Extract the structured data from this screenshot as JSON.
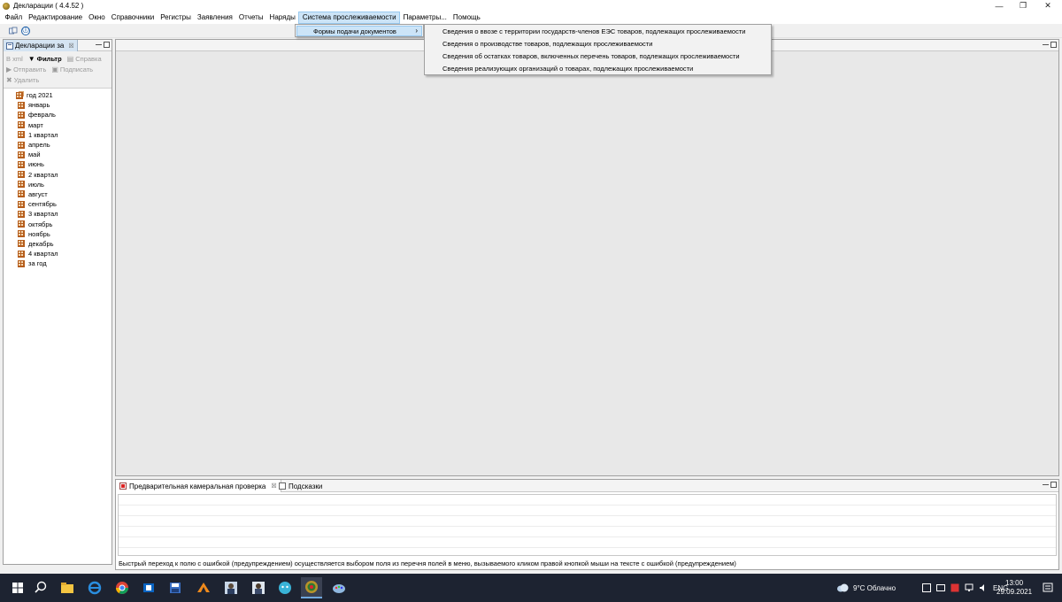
{
  "window": {
    "title": "Декларации ( 4.4.52 )",
    "controls": {
      "minimize": "—",
      "restore": "❐",
      "close": "✕"
    }
  },
  "menubar": {
    "items": [
      {
        "label": "Файл"
      },
      {
        "label": "Редактирование"
      },
      {
        "label": "Окно"
      },
      {
        "label": "Справочники"
      },
      {
        "label": "Регистры"
      },
      {
        "label": "Заявления"
      },
      {
        "label": "Отчеты"
      },
      {
        "label": "Наряды"
      },
      {
        "label": "Система прослеживаемости",
        "active": true
      },
      {
        "label": "Параметры..."
      },
      {
        "label": "Помощь"
      }
    ]
  },
  "toolbar": {
    "info_icon": "ⓘ",
    "sync_icon": "sync-icon"
  },
  "submenu": {
    "label": "Формы подачи документов",
    "arrow": "›",
    "items": [
      {
        "label": "Сведения о ввозе с территории государств-членов ЕЭС товаров, подлежащих прослеживаемости"
      },
      {
        "label": "Сведения о производстве товаров, подлежащих прослеживаемости"
      },
      {
        "label": "Сведения об остатках товаров, включенных перечень товаров, подлежащих прослеживаемости"
      },
      {
        "label": "Сведения реализующих организаций о товарах, подлежащих прослеживаемости"
      }
    ]
  },
  "left_panel": {
    "tab_label": "Декларации за",
    "tab_close": "☒",
    "actions": {
      "xml": "В xml",
      "filter": "Фильтр",
      "help": "Справка",
      "send": "Отправить",
      "sign": "Подписать",
      "delete": "Удалить"
    },
    "tree": {
      "root": "год 2021",
      "items": [
        {
          "label": "январь"
        },
        {
          "label": "февраль"
        },
        {
          "label": "март"
        },
        {
          "label": "1 квартал"
        },
        {
          "label": "апрель"
        },
        {
          "label": "май"
        },
        {
          "label": "июнь"
        },
        {
          "label": "2 квартал"
        },
        {
          "label": "июль"
        },
        {
          "label": "август"
        },
        {
          "label": "сентябрь"
        },
        {
          "label": "3 квартал"
        },
        {
          "label": "октябрь"
        },
        {
          "label": "ноябрь"
        },
        {
          "label": "декабрь"
        },
        {
          "label": "4 квартал"
        },
        {
          "label": "за год"
        }
      ]
    }
  },
  "bottom_panel": {
    "tabs": [
      {
        "label": "Предварительная камеральная проверка",
        "close": "☒"
      },
      {
        "label": "Подсказки"
      }
    ],
    "status": "Быстрый переход к полю с ошибкой (предупреждением) осуществляется выбором поля из перечня полей в меню, вызываемого кликом правой кнопкой мыши на тексте с ошибкой (предупреждением)"
  },
  "taskbar": {
    "weather": "9°C  Облачно",
    "language": "ENG",
    "time": "13:00",
    "date": "29.09.2021",
    "colors": {
      "background": "#1d2331",
      "accent": "#6fa7de"
    }
  }
}
